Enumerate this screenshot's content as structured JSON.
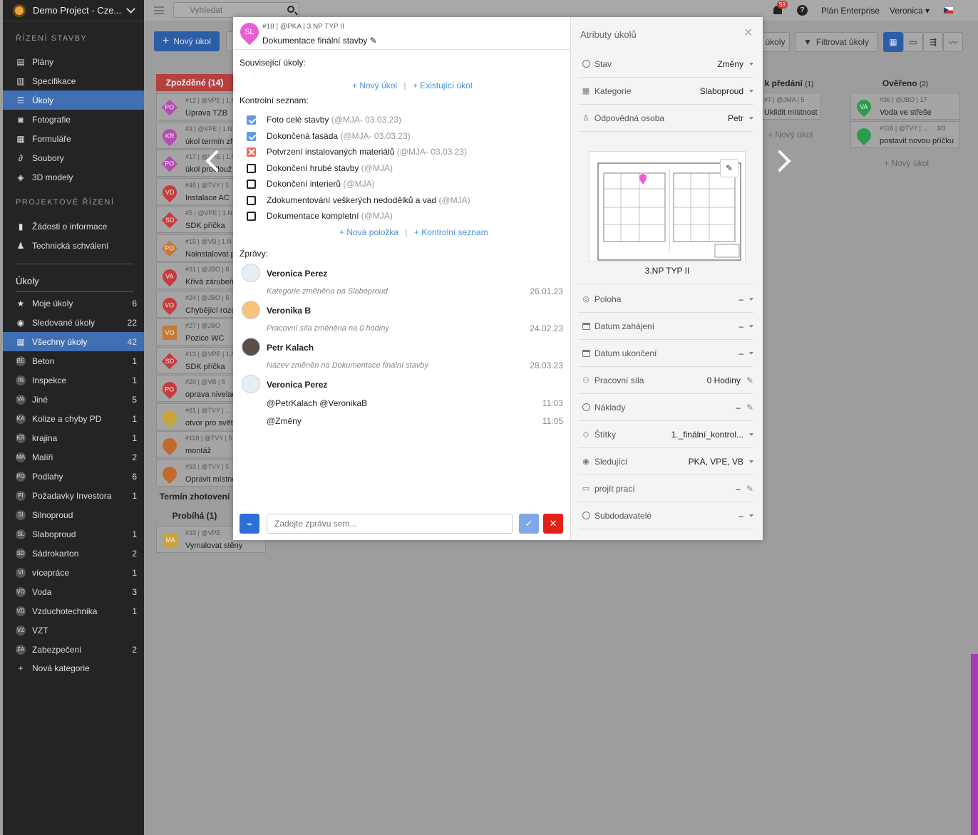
{
  "sidebar": {
    "project": "Demo Project - Cze...",
    "section_rizeni": "ŘÍZENÍ STAVBY",
    "nav": [
      {
        "label": "Plány",
        "icon": "map-icon"
      },
      {
        "label": "Specifikace",
        "icon": "book-icon"
      },
      {
        "label": "Úkoly",
        "icon": "list-icon",
        "active": true
      },
      {
        "label": "Fotografie",
        "icon": "camera-icon"
      },
      {
        "label": "Formuláře",
        "icon": "form-icon"
      },
      {
        "label": "Soubory",
        "icon": "paperclip-icon"
      },
      {
        "label": "3D modely",
        "icon": "cube-icon"
      }
    ],
    "section_projekt": "PROJEKTOVÉ ŘÍZENÍ",
    "nav2": [
      {
        "label": "Žádosti o informace",
        "icon": "document-icon"
      },
      {
        "label": "Technická schválení",
        "icon": "stamp-icon"
      }
    ],
    "tasks_title": "Úkoly",
    "filters": [
      {
        "label": "Moje úkoly",
        "count": "6",
        "icon": "star-icon"
      },
      {
        "label": "Sledované úkoly",
        "count": "22",
        "icon": "eye-icon"
      },
      {
        "label": "Všechny úkoly",
        "count": "42",
        "icon": "grid-icon",
        "active": true
      }
    ],
    "categories": [
      {
        "abbr": "BE",
        "label": "Beton",
        "count": "1"
      },
      {
        "abbr": "IN",
        "label": "Inspekce",
        "count": "1"
      },
      {
        "abbr": "VA",
        "label": "Jiné",
        "count": "5"
      },
      {
        "abbr": "KA",
        "label": "Kolize a chyby PD",
        "count": "1"
      },
      {
        "abbr": "KR",
        "label": "krajina",
        "count": "1"
      },
      {
        "abbr": "MA",
        "label": "Malíři",
        "count": "2"
      },
      {
        "abbr": "PO",
        "label": "Podlahy",
        "count": "6"
      },
      {
        "abbr": "PI",
        "label": "Požadavky Investora",
        "count": "1"
      },
      {
        "abbr": "SI",
        "label": "Silnoproud",
        "count": ""
      },
      {
        "abbr": "SL",
        "label": "Slaboproud",
        "count": "1"
      },
      {
        "abbr": "SD",
        "label": "Sádrokarton",
        "count": "2"
      },
      {
        "abbr": "VI",
        "label": "vícepráce",
        "count": "1"
      },
      {
        "abbr": "VO",
        "label": "Voda",
        "count": "3"
      },
      {
        "abbr": "VD",
        "label": "Vzduchotechnika",
        "count": "1"
      },
      {
        "abbr": "VZ",
        "label": "VZT",
        "count": ""
      },
      {
        "abbr": "ZA",
        "label": "Zabezpečení",
        "count": "2"
      }
    ],
    "new_category": "Nová kategorie"
  },
  "topbar": {
    "search_placeholder": "Vyhledat",
    "notifications": "59",
    "plan": "Plán Enterprise",
    "user": "Veronica"
  },
  "board": {
    "new_task": "Nový úkol",
    "btn_ukoly": "úkoly",
    "btn_filter": "Filtrovat úkoly",
    "col_delayed": "Zpožděné (14)",
    "col_handover": "k předání",
    "col_handover_count": "(1)",
    "col_verified": "Ověřeno",
    "col_verified_count": "(2)",
    "col_term": "Termín zhotovení",
    "col_running": "Probíhá (1)",
    "add_task": "+ Nový úkol",
    "cards": [
      {
        "abbr": "PO",
        "meta": "#12 | @VPE | 1.N",
        "name": "Úprava TZB",
        "color": "#b44db0",
        "shape": "dia"
      },
      {
        "abbr": "KR",
        "meta": "#3 | @VPE | 1.N",
        "name": "úkol termín zh",
        "color": "#b44db0",
        "shape": "pin"
      },
      {
        "abbr": "PO",
        "meta": "#17 | @VPE | 1.N",
        "name": "úkol prodlouž",
        "color": "#b44db0",
        "shape": "dia"
      },
      {
        "abbr": "VD",
        "meta": "#45 | @TVY | 5",
        "name": "Instalace AC",
        "color": "#c63c3c",
        "shape": "pin"
      },
      {
        "abbr": "SD",
        "meta": "#5 | @VPE | 1.N",
        "name": "SDK příčka",
        "color": "#c63c3c",
        "shape": "dia"
      },
      {
        "abbr": "PO",
        "meta": "#15 | @VB | 1.N",
        "name": "Nainstalovat p",
        "color": "#c77a33",
        "shape": "dia"
      },
      {
        "abbr": "VA",
        "meta": "#31 | @JBO | 8",
        "name": "Křivá zárubeň",
        "color": "#c63c3c",
        "shape": "pin"
      },
      {
        "abbr": "VO",
        "meta": "#24 | @JBO | 5",
        "name": "Chybějící roze",
        "color": "#c63c3c",
        "shape": "pin"
      },
      {
        "abbr": "VO",
        "meta": "#27 | @JBO",
        "name": "Pozice WC",
        "color": "#c77a33",
        "shape": "sq"
      },
      {
        "abbr": "SD",
        "meta": "#13 | @VPE | 1.N",
        "name": "SDK příčka",
        "color": "#c63c3c",
        "shape": "dia"
      },
      {
        "abbr": "PO",
        "meta": "#20 | @VB | 5",
        "name": "oprava nivelac",
        "color": "#c63c3c",
        "shape": "pin"
      },
      {
        "abbr": "",
        "meta": "#81 | @TVY | ...",
        "name": "otvor pro svět",
        "color": "#c9a437",
        "shape": "pin"
      },
      {
        "abbr": "",
        "meta": "#118 | @TVY | 5",
        "name": "montáž",
        "color": "#c16a2d",
        "shape": "pin"
      },
      {
        "abbr": "",
        "meta": "#93 | @TVY | 5",
        "name": "Opravit místnc",
        "color": "#c16a2d",
        "shape": "pin"
      }
    ],
    "running_card": {
      "abbr": "MA",
      "meta": "#33 | @VPE",
      "name": "Vymalovat stěny",
      "color": "#c9a437"
    },
    "handover_card": {
      "meta": "#7 | @JMA | 5",
      "name": "Uklidit místnost"
    },
    "verified_cards": [
      {
        "abbr": "VA",
        "meta": "#36 | @JBO | 17",
        "name": "Voda ve střeše"
      },
      {
        "abbr": "",
        "meta": "#116 | @TVY | ...",
        "name": "postavit novou příčku",
        "progress": "3/3"
      }
    ]
  },
  "modal": {
    "pin": "SL",
    "meta": "#18 | @PKA | 3.NP TYP II",
    "title": "Dokumentace finální stavby",
    "related_label": "Související úkoly:",
    "new_task_link": "+ Nový úkol",
    "existing_task_link": "+ Existující úkol",
    "checklist_label": "Kontrolní seznam:",
    "checklist": [
      {
        "text": "Foto celé stavby",
        "who": "(@MJA- 03.03.23)",
        "state": "checked"
      },
      {
        "text": "Dokončená fasáda",
        "who": "(@MJA- 03.03.23)",
        "state": "checked"
      },
      {
        "text": "Potvrzení instalovaných materiálů",
        "who": "(@MJA- 03.03.23)",
        "state": "rejected"
      },
      {
        "text": "Dokončení hrubé stavby",
        "who": "(@MJA)",
        "state": "unchecked"
      },
      {
        "text": "Dokončení interierů",
        "who": "(@MJA)",
        "state": "unchecked"
      },
      {
        "text": "Zdokumentování veškerých nedodělků a vad",
        "who": "(@MJA)",
        "state": "unchecked"
      },
      {
        "text": "Dokumentace kompletní",
        "who": "(@MJA)",
        "state": "unchecked"
      }
    ],
    "new_item_link": "+ Nová položka",
    "new_checklist_link": "+ Kontrolní seznam",
    "messages_label": "Zprávy:",
    "messages": [
      {
        "author": "Veronica Perez",
        "text": "Kategorie změněna na Slaboproud",
        "date": "26.01.23"
      },
      {
        "author": "Veronika B",
        "text": "Pracovní síla změněna na 0 hodiny",
        "date": "24.02.23"
      },
      {
        "author": "Petr Kalach",
        "text": "Název změněn na Dokumentace finální stavby",
        "date": "28.03.23"
      },
      {
        "author": "Veronica Perez",
        "posts": [
          {
            "text": "@PetrKalach @VeronikaB",
            "time": "11:03"
          },
          {
            "text": "@Změny",
            "time": "11:05"
          }
        ]
      }
    ],
    "message_placeholder": "Zadejte zprávu sem...",
    "attrs_title": "Atributy úkolů",
    "attrs": [
      {
        "label": "Stav",
        "value": "Změny",
        "icon": "status-icon",
        "ctl": "dropdown"
      },
      {
        "label": "Kategorie",
        "value": "Slaboproud",
        "icon": "grid-icon",
        "ctl": "dropdown"
      },
      {
        "label": "Odpovědná osoba",
        "value": "Petr",
        "icon": "user-icon",
        "ctl": "dropdown"
      }
    ],
    "plan_name": "3.NP TYP II",
    "attrs2": [
      {
        "label": "Poloha",
        "value": "–",
        "icon": "location-icon",
        "ctl": "dropdown"
      },
      {
        "label": "Datum zahájení",
        "value": "–",
        "icon": "calendar-icon",
        "ctl": "dropdown"
      },
      {
        "label": "Datum ukončení",
        "value": "–",
        "icon": "calendar-icon",
        "ctl": "dropdown"
      },
      {
        "label": "Pracovní síla",
        "value": "0  Hodiny",
        "icon": "workers-icon",
        "ctl": "edit"
      },
      {
        "label": "Náklady",
        "value": "–",
        "icon": "money-icon",
        "ctl": "edit"
      },
      {
        "label": "Štítky",
        "value": "1._finální_kontrol...",
        "icon": "tag-icon",
        "ctl": "dropdown"
      },
      {
        "label": "Sledující",
        "value": "PKA, VPE, VB",
        "icon": "eye-icon",
        "ctl": "dropdown"
      },
      {
        "label": "projít prací",
        "value": "–",
        "icon": "field-icon",
        "ctl": "edit"
      },
      {
        "label": "Subdodavatelé",
        "value": "–",
        "icon": "subcontractor-icon",
        "ctl": "dropdown"
      }
    ]
  }
}
